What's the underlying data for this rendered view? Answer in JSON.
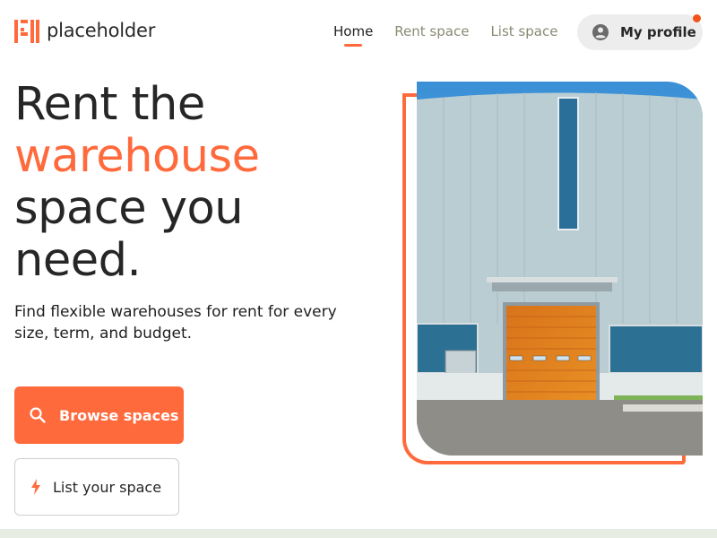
{
  "brand": {
    "name": "placeholder",
    "accent_color": "#ff6a3d"
  },
  "nav": {
    "items": [
      {
        "label": "Home",
        "active": true
      },
      {
        "label": "Rent space",
        "active": false
      },
      {
        "label": "List space",
        "active": false
      }
    ]
  },
  "profile": {
    "label": "My profile",
    "icon": "account-circle-icon",
    "notification": true
  },
  "hero": {
    "headline_line1": "Rent the",
    "headline_accent": "warehouse",
    "headline_line3": "space you",
    "headline_line4": "need.",
    "subtitle": "Find flexible warehouses for rent for every size, term, and budget.",
    "primary_button": {
      "label": "Browse spaces",
      "icon": "search-icon"
    },
    "secondary_button": {
      "label": "List your space",
      "icon": "bolt-icon"
    },
    "image": "warehouse-building-with-orange-door"
  }
}
